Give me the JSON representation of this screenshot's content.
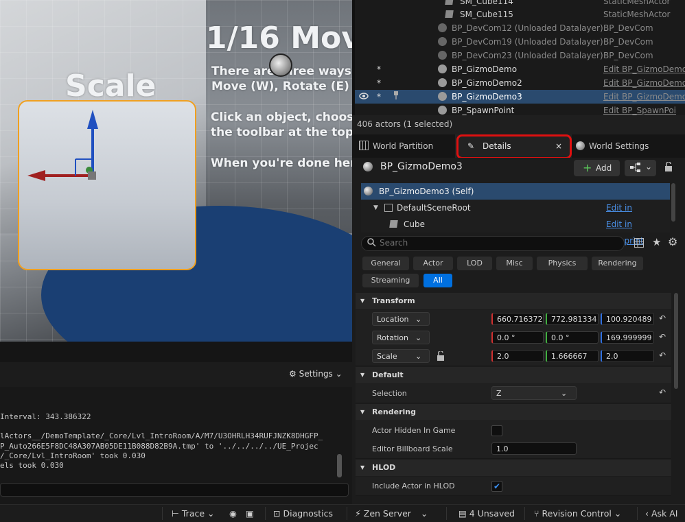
{
  "viewport": {
    "scale_label": "Scale",
    "title": "1/16 Mov",
    "line1": "There are three ways",
    "line2": "Move (W), Rotate (E)",
    "line3": "Click an object, choos",
    "line4": "the toolbar at the top",
    "line5": "When you're done her"
  },
  "outliner": {
    "rows": [
      {
        "name": "SM_Cube114",
        "type": "StaticMeshActor"
      },
      {
        "name": "SM_Cube115",
        "type": "StaticMeshActor"
      },
      {
        "name": "BP_DevCom12 (Unloaded Datalayer)",
        "type": "BP_DevCom"
      },
      {
        "name": "BP_DevCom19 (Unloaded Datalayer)",
        "type": "BP_DevCom"
      },
      {
        "name": "BP_DevCom23 (Unloaded Datalayer)",
        "type": "BP_DevCom"
      },
      {
        "name": "BP_GizmoDemo",
        "type": "Edit BP_GizmoDemo"
      },
      {
        "name": "BP_GizmoDemo2",
        "type": "Edit BP_GizmoDemo"
      },
      {
        "name": "BP_GizmoDemo3",
        "type": "Edit BP_GizmoDemo"
      },
      {
        "name": "BP_SpawnPoint",
        "type": "Edit BP_SpawnPoi"
      }
    ],
    "actor_count": "406 actors (1 selected)",
    "star": "*"
  },
  "tabs": {
    "world_partition": "World Partition",
    "details": "Details",
    "close": "×",
    "world_settings": "World Settings"
  },
  "details": {
    "actor_name": "BP_GizmoDemo3",
    "add_label": "Add",
    "components": [
      {
        "name": "BP_GizmoDemo3 (Self)",
        "action": ""
      },
      {
        "name": "DefaultSceneRoot",
        "action": "Edit in Blueprint"
      },
      {
        "name": "Cube",
        "action": "Edit in Blueprint"
      }
    ],
    "search_placeholder": "Search",
    "filters": [
      "General",
      "Actor",
      "LOD",
      "Misc",
      "Physics",
      "Rendering",
      "Streaming",
      "All"
    ],
    "transform_header": "Transform",
    "location_label": "Location",
    "location": [
      "660.716372",
      "772.981334",
      "100.920489"
    ],
    "rotation_label": "Rotation",
    "rotation": [
      "0.0 °",
      "0.0 °",
      "169.999999"
    ],
    "scale_label": "Scale",
    "scale": [
      "2.0",
      "1.666667",
      "2.0"
    ],
    "default_header": "Default",
    "selection_label": "Selection",
    "selection_value": "Z",
    "rendering_header": "Rendering",
    "actor_hidden_label": "Actor Hidden In Game",
    "billboard_label": "Editor Billboard Scale",
    "billboard_value": "1.0",
    "hlod_header": "HLOD",
    "include_hlod_label": "Include Actor in HLOD"
  },
  "log": {
    "settings_label": "Settings",
    "lines": [
      "Interval: 343.386322",
      "lActors__/DemoTemplate/_Core/Lvl_IntroRoom/A/M7/U3OHRLH34RUFJNZK8DHGFP_",
      "P_Auto266E5F8DC48A307AB05DE11B088D82B9A.tmp' to '../../../../UE_Projec",
      "/_Core/Lvl_IntroRoom' took 0.030",
      "els took 0.030"
    ]
  },
  "statusbar": {
    "trace": "Trace",
    "diagnostics": "Diagnostics",
    "zen_server": "Zen Server",
    "unsaved": "4 Unsaved",
    "revision_control": "Revision Control",
    "ask_ai": "Ask AI"
  },
  "colors": {
    "accent_blue": "#0070e0",
    "highlight_red": "#e01010",
    "selection_row": "#2a4a6e",
    "gizmo_selection": "#f0a020"
  }
}
